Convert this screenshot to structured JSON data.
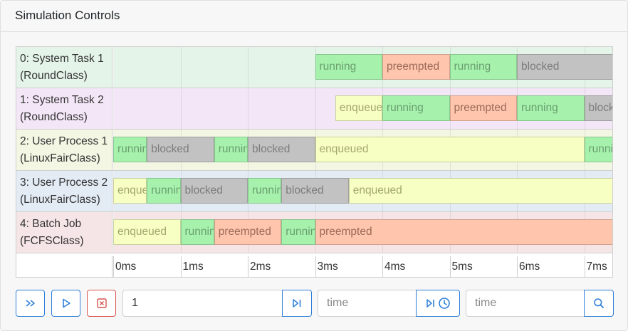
{
  "card": {
    "title": "Simulation Controls"
  },
  "tracks": [
    {
      "label_line1": "0: System Task 1",
      "label_line2": "(RoundClass)",
      "bg": "#e4f4e9",
      "segments": [
        {
          "state": "running",
          "label": "running",
          "start": 3,
          "end": 4
        },
        {
          "state": "preempted",
          "label": "preempted",
          "start": 4,
          "end": 5
        },
        {
          "state": "running",
          "label": "running",
          "start": 5,
          "end": 6
        },
        {
          "state": "blocked",
          "label": "blocked",
          "start": 6,
          "end": 7.5
        }
      ]
    },
    {
      "label_line1": "1: System Task 2",
      "label_line2": "(RoundClass)",
      "bg": "#f3e7f7",
      "segments": [
        {
          "state": "enqueued",
          "label": "enqueued",
          "start": 3.3,
          "end": 4
        },
        {
          "state": "running",
          "label": "running",
          "start": 4,
          "end": 5
        },
        {
          "state": "preempted",
          "label": "preempted",
          "start": 5,
          "end": 6
        },
        {
          "state": "running",
          "label": "running",
          "start": 6,
          "end": 7
        },
        {
          "state": "blocked",
          "label": "blocked",
          "start": 7,
          "end": 7.5
        }
      ]
    },
    {
      "label_line1": "2: User Process 1",
      "label_line2": "(LinuxFairClass)",
      "bg": "#f2f6e3",
      "segments": [
        {
          "state": "running",
          "label": "running",
          "start": 0,
          "end": 0.5
        },
        {
          "state": "blocked",
          "label": "blocked",
          "start": 0.5,
          "end": 1.5
        },
        {
          "state": "running",
          "label": "running",
          "start": 1.5,
          "end": 2
        },
        {
          "state": "blocked",
          "label": "blocked",
          "start": 2,
          "end": 3
        },
        {
          "state": "enqueued",
          "label": "enqueued",
          "start": 3,
          "end": 7
        },
        {
          "state": "running",
          "label": "running",
          "start": 7,
          "end": 7.5
        }
      ]
    },
    {
      "label_line1": "3: User Process 2",
      "label_line2": "(LinuxFairClass)",
      "bg": "#e3ebf5",
      "segments": [
        {
          "state": "enqueued",
          "label": "enqueued",
          "start": 0,
          "end": 0.5
        },
        {
          "state": "running",
          "label": "running",
          "start": 0.5,
          "end": 1
        },
        {
          "state": "blocked",
          "label": "blocked",
          "start": 1,
          "end": 2
        },
        {
          "state": "running",
          "label": "running",
          "start": 2,
          "end": 2.5
        },
        {
          "state": "blocked",
          "label": "blocked",
          "start": 2.5,
          "end": 3.5
        },
        {
          "state": "enqueued",
          "label": "enqueued",
          "start": 3.5,
          "end": 7.5
        }
      ]
    },
    {
      "label_line1": "4: Batch Job",
      "label_line2": "(FCFSClass)",
      "bg": "#f6e5e6",
      "segments": [
        {
          "state": "enqueued",
          "label": "enqueued",
          "start": 0,
          "end": 1
        },
        {
          "state": "running",
          "label": "running",
          "start": 1,
          "end": 1.5
        },
        {
          "state": "preempted",
          "label": "preempted",
          "start": 1.5,
          "end": 2.5
        },
        {
          "state": "running",
          "label": "running",
          "start": 2.5,
          "end": 3
        },
        {
          "state": "preempted",
          "label": "preempted",
          "start": 3,
          "end": 7.5
        }
      ]
    }
  ],
  "states": {
    "running": {
      "bg": "#a6f2ad",
      "fg": "#6b9e6f"
    },
    "preempted": {
      "bg": "#ffc5ad",
      "fg": "#9a6a58"
    },
    "blocked": {
      "bg": "#c2c2c2",
      "fg": "#7c7c7c"
    },
    "enqueued": {
      "bg": "#f7ffc2",
      "fg": "#a3a76f"
    }
  },
  "axis": {
    "ticks": [
      "0ms",
      "1ms",
      "2ms",
      "3ms",
      "4ms",
      "5ms",
      "6ms",
      "7ms"
    ]
  },
  "controls": {
    "step_count_value": "1",
    "time_placeholder_1": "time",
    "time_placeholder_2": "time"
  }
}
